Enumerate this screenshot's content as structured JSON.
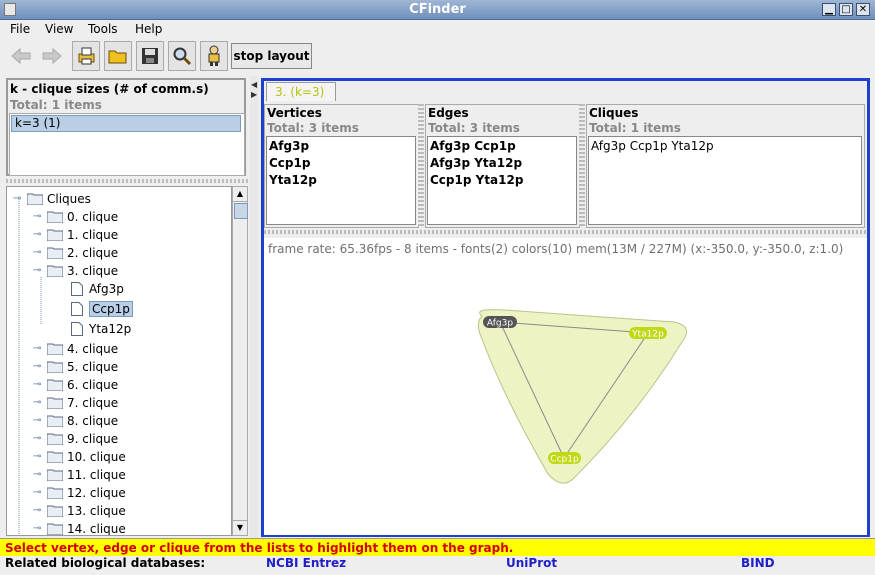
{
  "window": {
    "title": "CFinder"
  },
  "menubar": [
    "File",
    "View",
    "Tools",
    "Help"
  ],
  "toolbar": {
    "stop_layout_label": "stop layout"
  },
  "k_sizes": {
    "header": "k - clique sizes (# of comm.s)",
    "total": "Total: 1 items",
    "items": [
      "k=3 (1)"
    ]
  },
  "tree": {
    "root": "Cliques",
    "cliques": [
      "0. clique",
      "1. clique",
      "2. clique",
      "3. clique",
      "4. clique",
      "5. clique",
      "6. clique",
      "7. clique",
      "8. clique",
      "9. clique",
      "10. clique",
      "11. clique",
      "12. clique",
      "13. clique",
      "14. clique"
    ],
    "expanded_children": [
      "Afg3p",
      "Ccp1p",
      "Yta12p"
    ],
    "selected_child": "Ccp1p"
  },
  "tab": {
    "label": "3. (k=3)"
  },
  "vertices": {
    "header": "Vertices",
    "total": "Total: 3 items",
    "items": [
      "Afg3p",
      "Ccp1p",
      "Yta12p"
    ]
  },
  "edges": {
    "header": "Edges",
    "total": "Total: 3 items",
    "items": [
      "Afg3p Ccp1p",
      "Afg3p Yta12p",
      "Ccp1p Yta12p"
    ]
  },
  "cliques_box": {
    "header": "Cliques",
    "total": "Total: 1 items",
    "items": [
      "Afg3p Ccp1p Yta12p"
    ]
  },
  "graph": {
    "status_line": "frame rate: 65.36fps - 8 items - fonts(2) colors(10) mem(13M / 227M) (x:-350.0, y:-350.0, z:1.0)",
    "nodes": [
      "Afg3p",
      "Yta12p",
      "Ccp1p"
    ],
    "highlight_color": "#bfd916",
    "hull_color": "#eef3c4"
  },
  "status": {
    "message": "Select vertex, edge or clique from the lists to highlight them on the graph."
  },
  "databases": {
    "label": "Related biological databases:",
    "links": [
      "NCBI Entrez",
      "UniProt",
      "BIND"
    ]
  }
}
